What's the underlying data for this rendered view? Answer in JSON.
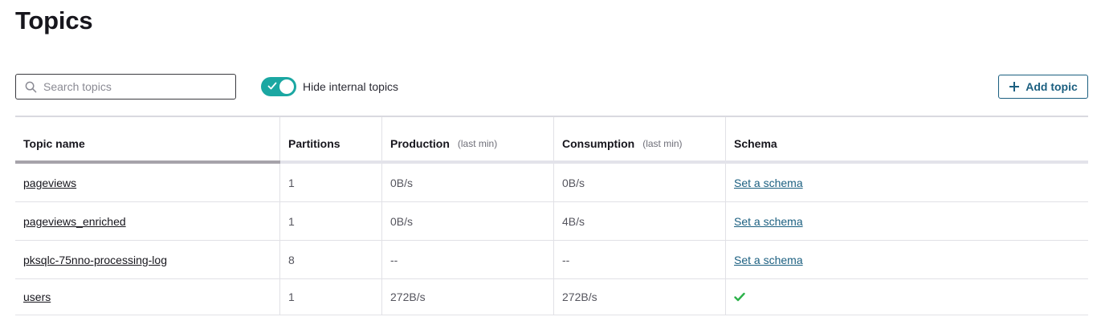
{
  "page": {
    "title": "Topics"
  },
  "search": {
    "placeholder": "Search topics",
    "value": ""
  },
  "toggle": {
    "label": "Hide internal topics",
    "on": true
  },
  "add_button": {
    "label": "Add topic"
  },
  "table": {
    "headers": {
      "name": "Topic name",
      "partitions": "Partitions",
      "production": "Production",
      "production_sub": "(last min)",
      "consumption": "Consumption",
      "consumption_sub": "(last min)",
      "schema": "Schema"
    },
    "rows": [
      {
        "name": "pageviews",
        "partitions": "1",
        "production": "0B/s",
        "consumption": "0B/s",
        "schema": "Set a schema"
      },
      {
        "name": "pageviews_enriched",
        "partitions": "1",
        "production": "0B/s",
        "consumption": "4B/s",
        "schema": "Set a schema"
      },
      {
        "name": "pksqlc-75nno-processing-log",
        "partitions": "8",
        "production": "--",
        "consumption": "--",
        "schema": "Set a schema"
      },
      {
        "name": "users",
        "partitions": "1",
        "production": "272B/s",
        "consumption": "272B/s",
        "schema_icon": "check-icon"
      }
    ]
  },
  "colors": {
    "accent": "#1ba7a2",
    "link": "#1b5f80",
    "success": "#2cb24a"
  }
}
